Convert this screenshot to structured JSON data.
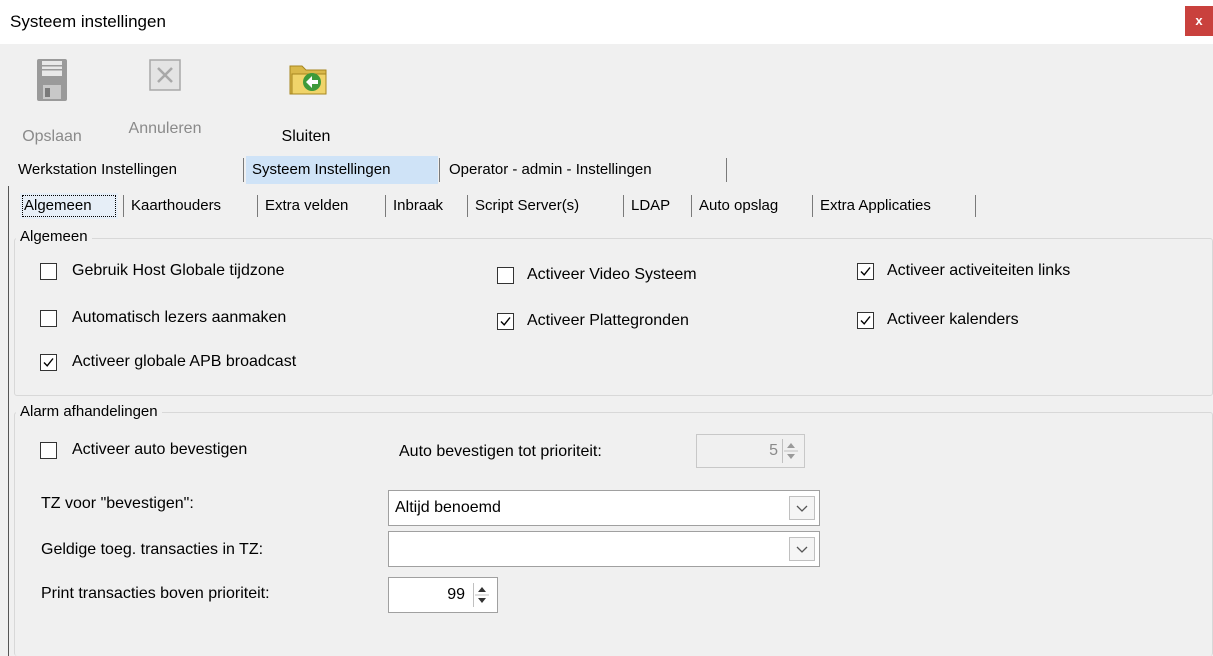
{
  "window": {
    "title": "Systeem instellingen",
    "close_glyph": "x",
    "close_color": "#c9413d"
  },
  "toolbar": {
    "save": {
      "label": "Opslaan",
      "icon": "floppy-disk-icon",
      "enabled": false
    },
    "cancel": {
      "label": "Annuleren",
      "icon": "cancel-x-icon",
      "enabled": false
    },
    "close": {
      "label": "Sluiten",
      "icon": "folder-exit-icon",
      "enabled": true
    }
  },
  "main_tabs": [
    {
      "label": "Werkstation Instellingen",
      "selected": false
    },
    {
      "label": "Systeem Instellingen",
      "selected": true
    },
    {
      "label": "Operator - admin - Instellingen",
      "selected": false
    }
  ],
  "sub_tabs": [
    {
      "label": "Algemeen",
      "selected": true
    },
    {
      "label": "Kaarthouders",
      "selected": false
    },
    {
      "label": "Extra velden",
      "selected": false
    },
    {
      "label": "Inbraak",
      "selected": false
    },
    {
      "label": "Script Server(s)",
      "selected": false
    },
    {
      "label": "LDAP",
      "selected": false
    },
    {
      "label": "Auto opslag",
      "selected": false
    },
    {
      "label": "Extra Applicaties",
      "selected": false
    }
  ],
  "general": {
    "title": "Algemeen",
    "options": [
      {
        "label": "Gebruik Host Globale tijdzone",
        "checked": false
      },
      {
        "label": "Automatisch lezers aanmaken",
        "checked": false
      },
      {
        "label": "Activeer globale APB broadcast",
        "checked": true
      },
      {
        "label": "Activeer Video Systeem",
        "checked": false
      },
      {
        "label": "Activeer  Plattegronden",
        "checked": true
      },
      {
        "label": "Activeer activeiteiten links",
        "checked": true
      },
      {
        "label": "Activeer kalenders",
        "checked": true
      }
    ]
  },
  "alarm": {
    "title": "Alarm afhandelingen",
    "auto_confirm": {
      "label": "Activeer auto bevestigen",
      "checked": false
    },
    "auto_confirm_priority": {
      "label": "Auto bevestigen tot prioriteit:",
      "value": "5",
      "enabled": false
    },
    "tz_confirm": {
      "label": "TZ voor \"bevestigen\":",
      "value": "Altijd benoemd"
    },
    "valid_transactions": {
      "label": "Geldige toeg. transacties in TZ:",
      "value": ""
    },
    "print_priority": {
      "label": "Print transacties boven prioriteit:",
      "value": "99"
    }
  }
}
